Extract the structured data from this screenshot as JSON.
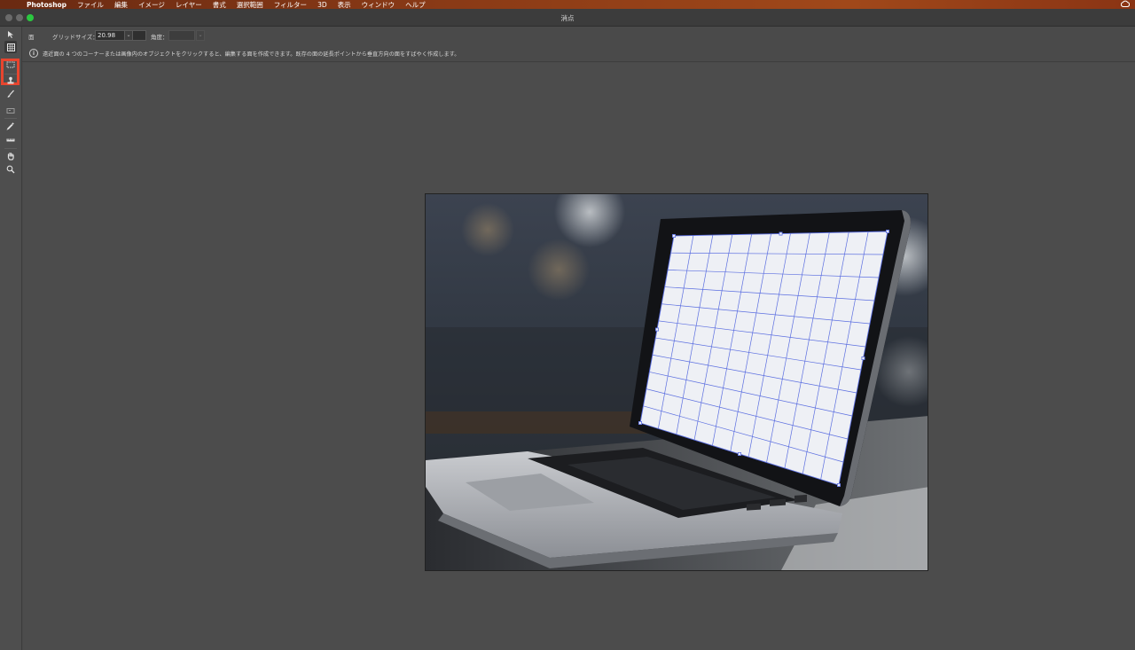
{
  "menubar": {
    "apple_glyph": "",
    "app_name": "Photoshop",
    "items": [
      "ファイル",
      "編集",
      "イメージ",
      "レイヤー",
      "書式",
      "選択範囲",
      "フィルター",
      "3D",
      "表示",
      "ウィンドウ",
      "ヘルプ"
    ]
  },
  "window": {
    "title": "消点"
  },
  "tools": [
    {
      "name": "edit-plane-tool",
      "glyph": "⇱"
    },
    {
      "name": "create-plane-tool",
      "glyph": "▦"
    },
    {
      "name": "marquee-tool",
      "glyph": "⬚"
    },
    {
      "name": "stamp-tool",
      "glyph": "⛉"
    },
    {
      "name": "brush-tool",
      "glyph": "✎"
    },
    {
      "name": "transform-tool",
      "glyph": "⊡"
    },
    {
      "name": "eyedropper-tool",
      "glyph": "✐"
    },
    {
      "name": "measure-tool",
      "glyph": "▬"
    },
    {
      "name": "hand-tool",
      "glyph": "✋"
    },
    {
      "name": "zoom-tool",
      "glyph": "⚲"
    }
  ],
  "options": {
    "mode_label": "面",
    "grid_size_label": "グリッドサイズ：",
    "grid_size_value": "20.98",
    "angle_label": "角度：",
    "angle_value": ""
  },
  "info": {
    "message": "遠近面の 4 つのコーナーまたは画像内のオブジェクトをクリックすると、編集する面を作成できます。既存の面の延長ポイントから垂直方向の面をすばやく作成します。"
  },
  "colors": {
    "highlight": "#e8452e",
    "grid_line": "#5b6ee0",
    "screen": "#eef0f5"
  }
}
